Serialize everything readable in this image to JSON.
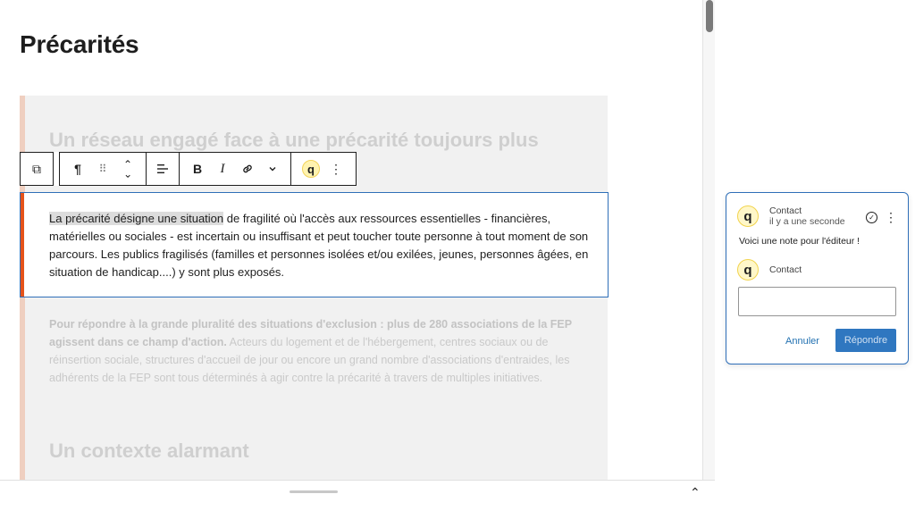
{
  "page_title": "Précarités",
  "faded_heading": "Un réseau engagé face à une précarité toujours plus",
  "active_paragraph": {
    "highlighted": "La précarité désigne une situation",
    "rest": " de fragilité où l'accès aux ressources essentielles - financières, matérielles ou sociales - est incertain ou insuffisant et peut toucher toute personne à tout moment de son parcours. Les publics fragilisés (familles et personnes isolées et/ou exilées, jeunes, personnes âgées, en situation de handicap....) y sont plus exposés."
  },
  "faded_paragraph": {
    "bold": "Pour répondre à la grande pluralité des situations d'exclusion : plus de 280 associations de la FEP agissent dans ce champ d'action.",
    "rest": " Acteurs du logement et de l'hébergement, centres sociaux ou de réinsertion sociale, structures d'accueil de jour ou encore un grand nombre d'associations d'entraides, les adhérents de la FEP sont tous déterminés à agir contre la précarité à travers de multiples initiatives."
  },
  "faded_heading_2": "Un contexte alarmant",
  "toolbar": {
    "transform": "⧉",
    "paragraph": "¶",
    "drag": "⠿",
    "move": "⌃",
    "align": "☰",
    "bold": "B",
    "italic": "I",
    "link": "🔗",
    "more_format": "⌄",
    "comment": "q",
    "options": "⋮"
  },
  "comment": {
    "author": "Contact",
    "time": "il y a une seconde",
    "text": "Voici une note pour l'éditeur !",
    "reply_author": "Contact",
    "avatar_letter": "q",
    "cancel_label": "Annuler",
    "reply_label": "Répondre"
  },
  "bottom": {
    "toggle": "⌃"
  }
}
